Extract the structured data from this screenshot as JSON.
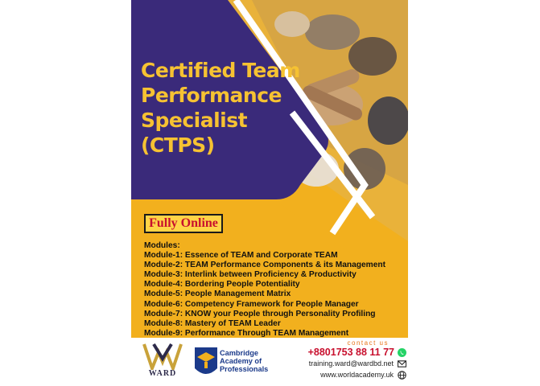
{
  "poster": {
    "title_lines": [
      "Certified Team",
      "Performance",
      "Specialist",
      "(CTPS)"
    ],
    "badge": "Fully Online",
    "modules_heading": "Modules:",
    "modules": [
      "Module-1: Essence of TEAM and Corporate TEAM",
      "Module-2: TEAM Performance Components & its Management",
      "Module-3: Interlink between Proficiency & Productivity",
      "Module-4: Bordering People Potentiality",
      "Module-5: People Management Matrix",
      "Module-6: Competency Framework for People Manager",
      "Module-7: KNOW your People through Personality Profiling",
      "Module-8: Mastery of TEAM Leader",
      "Module-9: Performance Through TEAM Management"
    ],
    "colors": {
      "yellow": "#f2b01e",
      "purple": "#3a2a7a",
      "title": "#f6c232",
      "badge_text": "#c8102e"
    }
  },
  "footer": {
    "ward_logo_text": "WARD",
    "cap_logo_lines": [
      "Cambridge",
      "Academy of",
      "Professionals"
    ],
    "contact_label": "contact us",
    "phone": "+8801753 88 11 77",
    "email": "training.ward@wardbd.net",
    "website": "www.worldacademy.uk",
    "icons": [
      "whatsapp-icon",
      "email-icon",
      "globe-icon"
    ]
  }
}
